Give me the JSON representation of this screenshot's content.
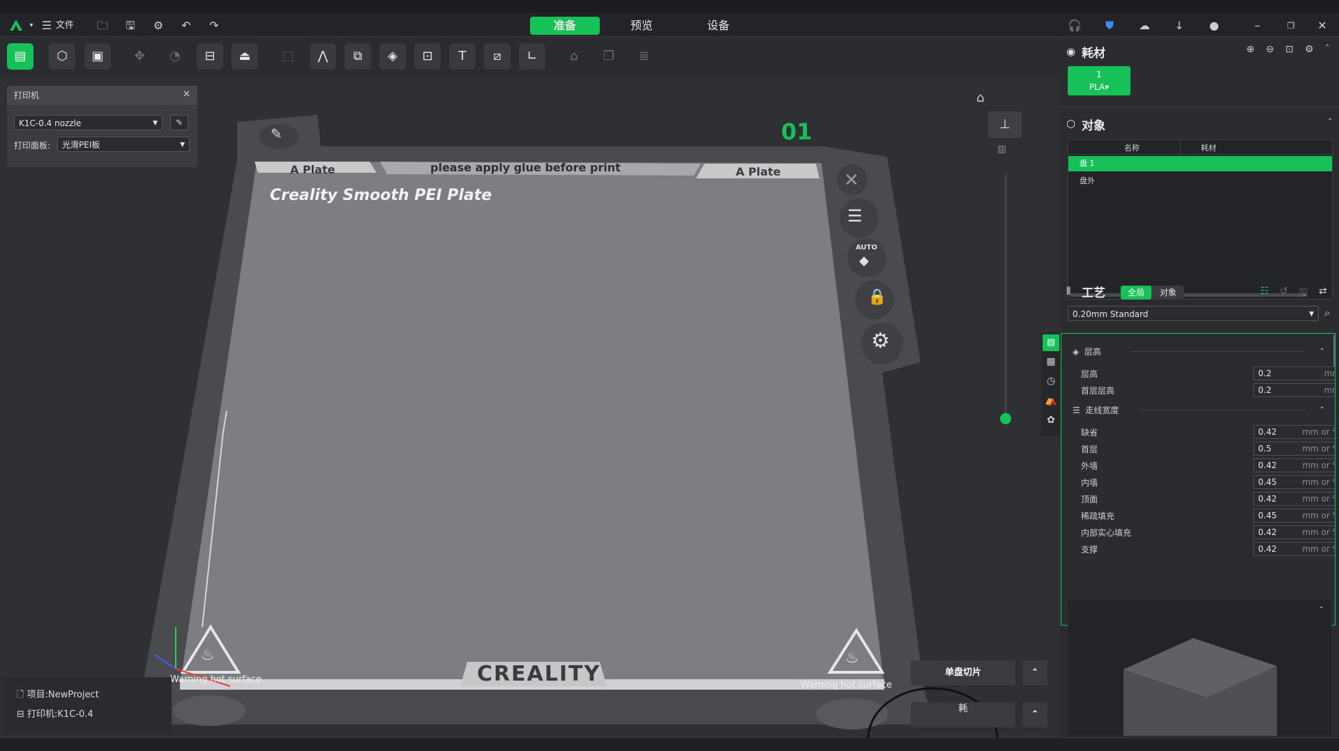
{
  "app": {
    "menu_file": "文件",
    "tabs": [
      "准备",
      "预览",
      "设备"
    ],
    "accent": "#17c15a"
  },
  "printer_panel": {
    "title": "打印机",
    "printer_value": "K1C-0.4 nozzle",
    "plate_label": "打印面板:",
    "plate_value": "光滑PEI板"
  },
  "bed": {
    "plate_label_left": "A Plate",
    "plate_label_right": "A Plate",
    "notice": "please apply glue before print",
    "plate_name": "Creality Smooth PEI Plate",
    "plate_number": "01",
    "brand": "CREALITY",
    "warning_left": "Warning hot surface",
    "warning_right": "Warning hot surface",
    "auto_label": "AUTO"
  },
  "bottom_left": {
    "project": "项目:NewProject",
    "printer": "打印机:K1C-0.4"
  },
  "bottom_buttons": {
    "slice_label": "单盘切片",
    "second_partial": "耗"
  },
  "filament": {
    "title": "耗材",
    "slot_number": "1",
    "slot_type": "PLA"
  },
  "objects": {
    "title": "对象",
    "col_name": "名称",
    "col_filament": "耗材",
    "rows": [
      "盘 1",
      "盘外"
    ]
  },
  "process": {
    "title": "工艺",
    "toggle_global": "全局",
    "toggle_object": "对象",
    "preset": "0.20mm Standard",
    "group_layer": "层高",
    "layer_rows": [
      {
        "label": "层高",
        "value": "0.2",
        "unit": "mm"
      },
      {
        "label": "首层层高",
        "value": "0.2",
        "unit": "mm"
      }
    ],
    "group_width": "走线宽度",
    "width_rows": [
      {
        "label": "缺省",
        "value": "0.42",
        "unit": "mm or %"
      },
      {
        "label": "首层",
        "value": "0.5",
        "unit": "mm or %"
      },
      {
        "label": "外墙",
        "value": "0.42",
        "unit": "mm or %"
      },
      {
        "label": "内墙",
        "value": "0.45",
        "unit": "mm or %"
      },
      {
        "label": "顶面",
        "value": "0.42",
        "unit": "mm or %"
      },
      {
        "label": "稀疏填充",
        "value": "0.45",
        "unit": "mm or %"
      },
      {
        "label": "内部实心填充",
        "value": "0.42",
        "unit": "mm or %"
      },
      {
        "label": "支撑",
        "value": "0.42",
        "unit": "mm or %"
      }
    ]
  }
}
